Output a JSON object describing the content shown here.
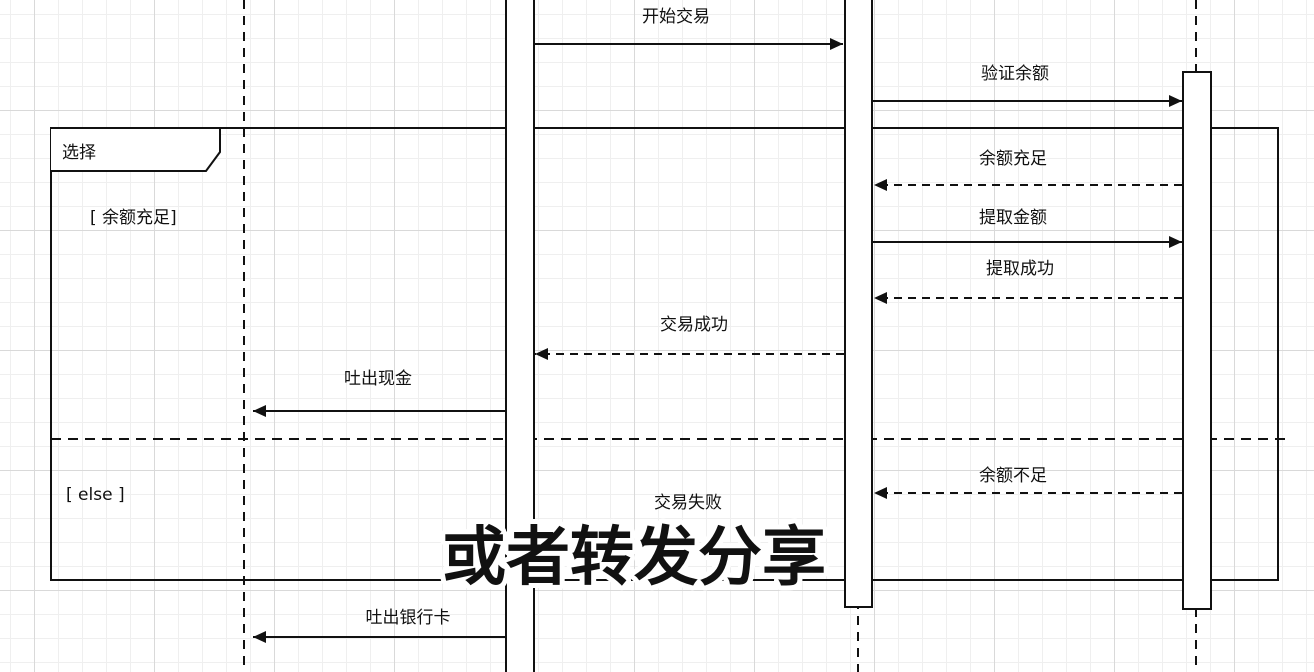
{
  "fragment": {
    "operator": "选择",
    "guard_1": "[ 余额充足]",
    "guard_2": "[ else ]"
  },
  "messages": {
    "start_transaction": "开始交易",
    "verify_balance": "验证余额",
    "balance_sufficient": "余额充足",
    "withdraw_amount": "提取金额",
    "withdraw_success": "提取成功",
    "transaction_success": "交易成功",
    "dispense_cash": "吐出现金",
    "balance_insufficient": "余额不足",
    "transaction_failed": "交易失败",
    "eject_card": "吐出银行卡"
  },
  "overlay": {
    "caption": "或者转发分享"
  },
  "colors": {
    "line": "#111111",
    "grid_major": "#d9d9d9",
    "grid_minor": "#efefef",
    "background": "#ffffff"
  }
}
